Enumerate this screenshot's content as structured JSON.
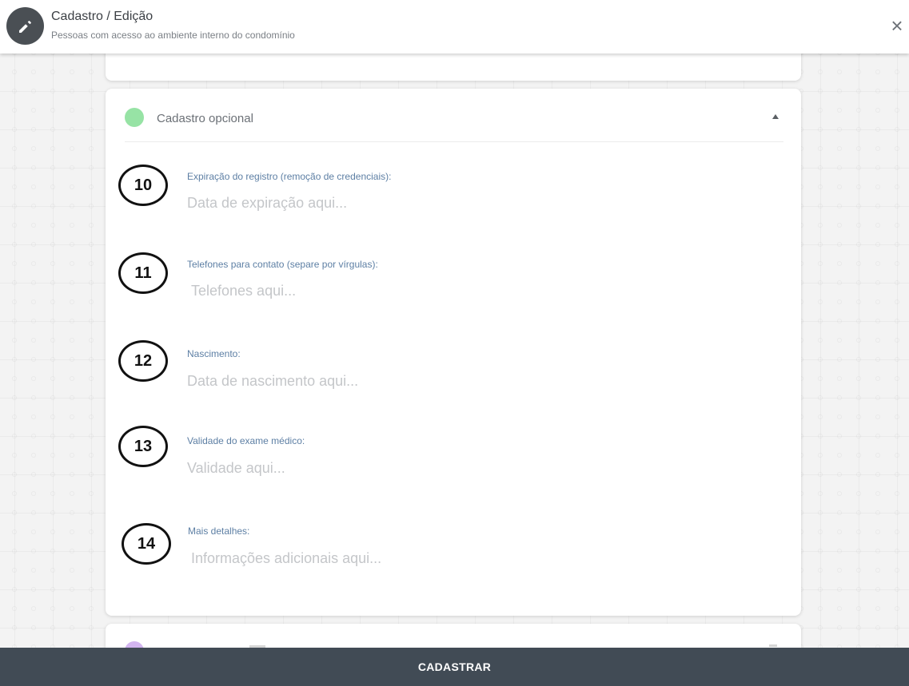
{
  "header": {
    "title": "Cadastro / Edição",
    "subtitle": "Pessoas com acesso ao ambiente interno do condomínio",
    "avatar_icon": "pencil-icon",
    "close_label": "×"
  },
  "section": {
    "title": "Cadastro opcional",
    "status_color": "#97e3a5",
    "collapse_icon": "caret-up-icon"
  },
  "fields": [
    {
      "step": "10",
      "label": "Expiração do registro (remoção de credenciais):",
      "placeholder": "Data de expiração aqui..."
    },
    {
      "step": "11",
      "label": "Telefones para contato (separe por vírgulas):",
      "placeholder": "Telefones aqui..."
    },
    {
      "step": "12",
      "label": "Nascimento:",
      "placeholder": "Data de nascimento aqui..."
    },
    {
      "step": "13",
      "label": "Validade do exame médico:",
      "placeholder": "Validade aqui..."
    },
    {
      "step": "14",
      "label": "Mais detalhes:",
      "placeholder": "Informações adicionais aqui..."
    }
  ],
  "next_section": {
    "status_color": "#d3b5f0"
  },
  "footer": {
    "submit_label": "CADASTRAR",
    "color": "#414b55"
  }
}
